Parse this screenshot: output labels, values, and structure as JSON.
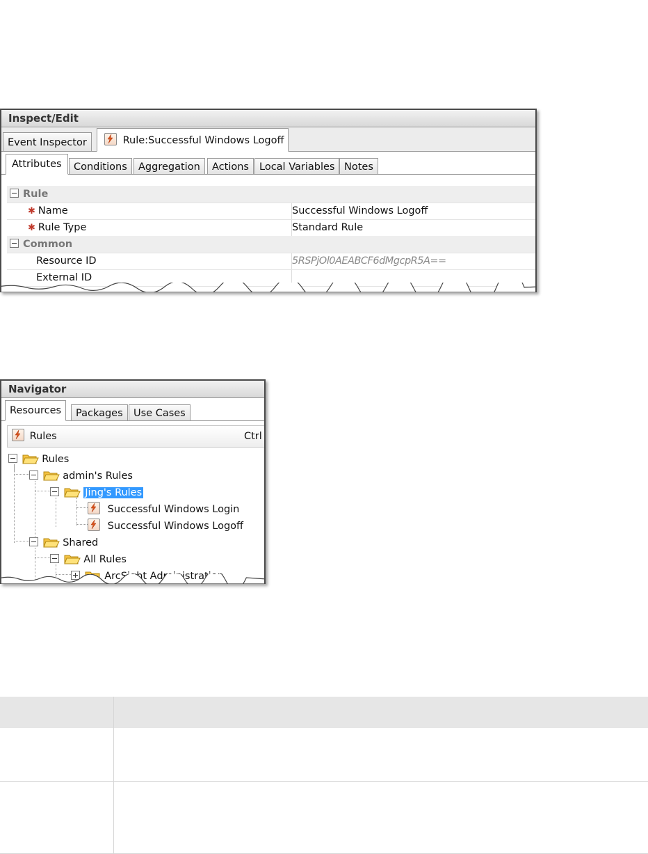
{
  "inspect": {
    "title": "Inspect/Edit",
    "doc_tabs": [
      "Event Inspector",
      "Rule:Successful Windows Logoff"
    ],
    "sub_tabs": [
      "Attributes",
      "Conditions",
      "Aggregation",
      "Actions",
      "Local Variables",
      "Notes"
    ],
    "sections": {
      "rule": "Rule",
      "common": "Common"
    },
    "fields": {
      "name_label": "Name",
      "name_value": "Successful Windows Logoff",
      "type_label": "Rule Type",
      "type_value": "Standard Rule",
      "resid_label": "Resource ID",
      "resid_value": "5RSPjOl0AEABCF6dMgcpR5A==",
      "extid_label": "External ID",
      "extid_value": ""
    },
    "colors": {
      "required": "#c0392b",
      "selection": "#3399ff"
    }
  },
  "navigator": {
    "title": "Navigator",
    "tabs": [
      "Resources",
      "Packages",
      "Use Cases"
    ],
    "resource_type": "Rules",
    "shortcut": "Ctrl",
    "tree": {
      "root": "Rules",
      "admin": "admin's Rules",
      "jing": "Jing's Rules",
      "login": "Successful Windows Login",
      "logoff": "Successful Windows Logoff",
      "shared": "Shared",
      "all_rules": "All Rules",
      "arcsight": "ArcSight Administration"
    }
  }
}
